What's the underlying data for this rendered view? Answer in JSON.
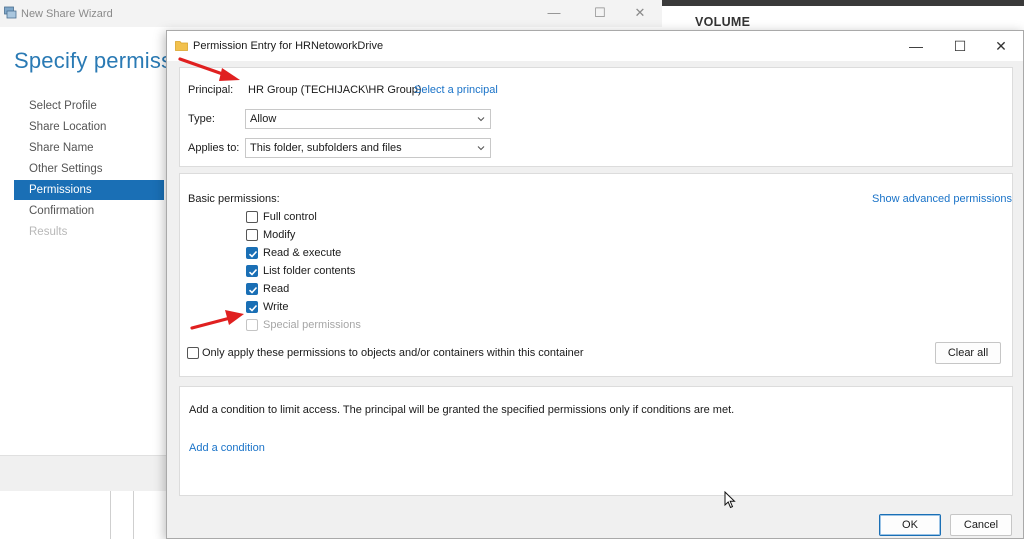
{
  "wizard": {
    "title": "New Share Wizard",
    "heading": "Specify permissio",
    "steps": [
      {
        "label": "Select Profile",
        "state": "normal"
      },
      {
        "label": "Share Location",
        "state": "normal"
      },
      {
        "label": "Share Name",
        "state": "normal"
      },
      {
        "label": "Other Settings",
        "state": "normal"
      },
      {
        "label": "Permissions",
        "state": "active"
      },
      {
        "label": "Confirmation",
        "state": "normal"
      },
      {
        "label": "Results",
        "state": "disabled"
      }
    ]
  },
  "server": {
    "section_title": "VOLUME"
  },
  "dialog": {
    "title": "Permission Entry for HRNetoworkDrive",
    "principal": {
      "label": "Principal:",
      "value": "HR Group (TECHIJACK\\HR Group)",
      "select_link": "Select a principal"
    },
    "type": {
      "label": "Type:",
      "value": "Allow"
    },
    "applies_to": {
      "label": "Applies to:",
      "value": "This folder, subfolders and files"
    },
    "basic_permissions": {
      "label": "Basic permissions:",
      "advanced_link": "Show advanced permissions",
      "items": [
        {
          "label": "Full control",
          "checked": false,
          "disabled": false
        },
        {
          "label": "Modify",
          "checked": false,
          "disabled": false
        },
        {
          "label": "Read & execute",
          "checked": true,
          "disabled": false
        },
        {
          "label": "List folder contents",
          "checked": true,
          "disabled": false
        },
        {
          "label": "Read",
          "checked": true,
          "disabled": false
        },
        {
          "label": "Write",
          "checked": true,
          "disabled": false
        },
        {
          "label": "Special permissions",
          "checked": false,
          "disabled": true
        }
      ],
      "only_apply_label": "Only apply these permissions to objects and/or containers within this container",
      "clear_all_label": "Clear all"
    },
    "condition": {
      "text": "Add a condition to limit access. The principal will be granted the specified permissions only if conditions are met.",
      "add_link": "Add a condition"
    },
    "ok_label": "OK",
    "cancel_label": "Cancel"
  },
  "colors": {
    "accent": "#1a6fb5",
    "link": "#1a73c8",
    "heading": "#2a7ab4",
    "annotation_arrow": "#e02020"
  }
}
